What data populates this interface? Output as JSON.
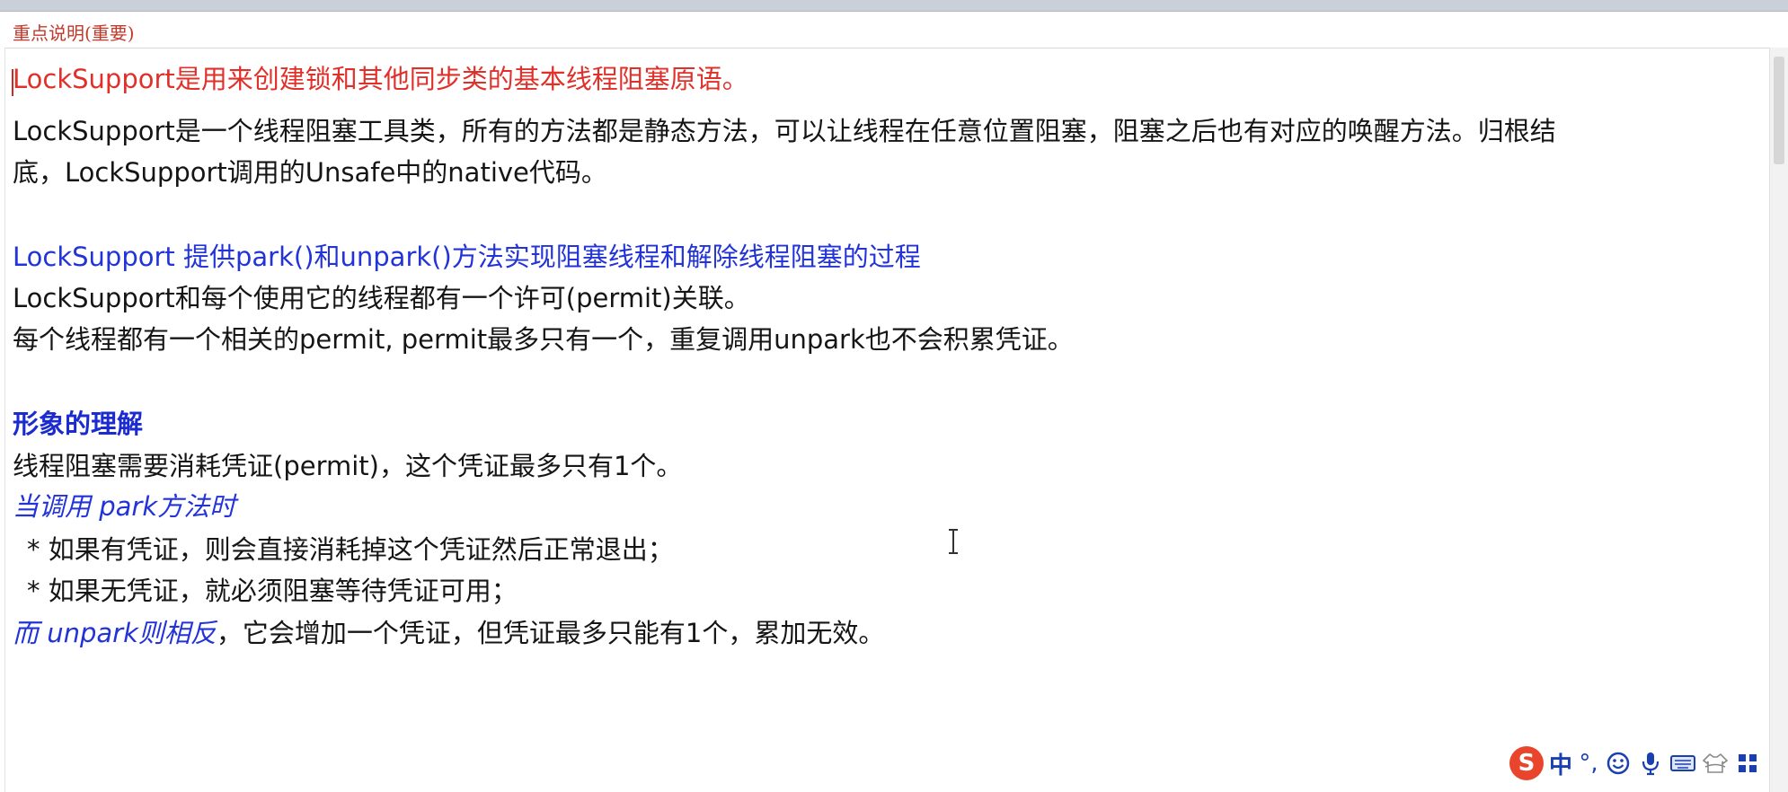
{
  "header": {
    "title": "重点说明(重要)"
  },
  "document": {
    "l1": {
      "a": "LockSupport是用来创建锁和其他同步类的基本线程阻塞原语。"
    },
    "l2": {
      "a": "LockSupport是一个线程阻塞工具类，所有的方法都是静态方法，可以让线程在任意位置阻塞，阻塞之后也有对应的唤醒方法。归根结"
    },
    "l3": {
      "a": "底，LockSupport调用的Unsafe中的native代码。"
    },
    "l4": {
      "a": "LockSupport 提供park()和unpark()方法实现阻塞线程和解除线程阻塞的过程"
    },
    "l5": {
      "a": "LockSupport和每个使用它的线程都有一个许可(permit)关联。"
    },
    "l6": {
      "a": "每个线程都有一个相关的permit, permit最多只有一个，重复调用unpark也不会积累凭证。"
    },
    "l7": {
      "a": "形象的理解"
    },
    "l8": {
      "a": "线程阻塞需要消耗凭证(permit)，这个凭证最多只有1个。"
    },
    "l9": {
      "a": "当调用 park方法时"
    },
    "l10": {
      "a": "  * 如果有凭证，则会直接消耗掉这个凭证然后正常退出；"
    },
    "l11": {
      "a": "  * 如果无凭证，就必须阻塞等待凭证可用；"
    },
    "l12": {
      "a": "而 unpark则相反",
      "b": "，它会增加一个凭证，但凭证最多只能有1个，累加无效。"
    }
  },
  "ime": {
    "logo": "S",
    "mode": "中",
    "punct": "°,",
    "icons": [
      "smiley-icon",
      "microphone-icon",
      "keyboard-icon",
      "clothing-icon",
      "tools-icon"
    ]
  },
  "colors": {
    "red": "#e0302a",
    "blue": "#2233d8",
    "header_red": "#c0392b",
    "ime_orange": "#e8452c",
    "ime_blue": "#1a3fb0"
  }
}
